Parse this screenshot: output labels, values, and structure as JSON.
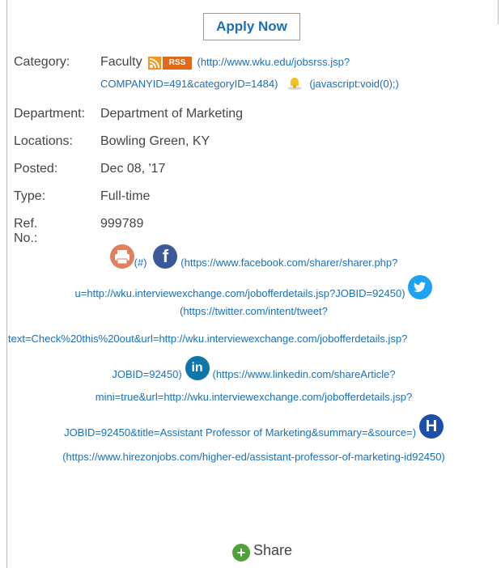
{
  "apply_label": "Apply Now",
  "fields": {
    "category_label": "Category:",
    "category_value": "Faculty",
    "rss_badge": "RSS",
    "rss_url_line1": "(http://www.wku.edu/jobsrss.jsp?",
    "rss_url_line2": "COMPANYID=491&categoryID=1484)",
    "alert_url": "(javascript:void(0);)",
    "department_label": "Department:",
    "department_value": "Department of Marketing",
    "locations_label": "Locations:",
    "locations_value": "Bowling Green, KY",
    "posted_label": "Posted:",
    "posted_value": "Dec 08, '17",
    "type_label": "Type:",
    "type_value": "Full-time",
    "ref_label": "Ref. No.:",
    "ref_value": "999789"
  },
  "share_links": {
    "print_href": "(#)",
    "facebook_line1": "(https://www.facebook.com/sharer/sharer.php?",
    "facebook_line2": "u=http://wku.interviewexchange.com/jobofferdetails.jsp?JOBID=92450)",
    "twitter_line1": "(https://twitter.com/intent/tweet?",
    "twitter_line2": "text=Check%20this%20out&url=http://wku.interviewexchange.com/jobofferdetails.jsp?",
    "twitter_line3": "JOBID=92450)",
    "linkedin_line1": "(https://www.linkedin.com/shareArticle?",
    "linkedin_line2": "mini=true&url=http://wku.interviewexchange.com/jobofferdetails.jsp?",
    "linkedin_line3": "JOBID=92450&title=Assistant Professor of Marketing&summary=&source=)",
    "hirezon_line": "(https://www.hirezonjobs.com/higher-ed/assistant-professor-of-marketing-id92450)",
    "share_label": "Share",
    "icon_print": "print-icon",
    "icon_facebook": "facebook-icon",
    "icon_twitter": "twitter-icon",
    "icon_linkedin": "linkedin-icon",
    "icon_hirezon": "hirezon-icon",
    "icon_share": "plus-icon"
  },
  "colors": {
    "link": "#1b6fb8",
    "print": "#e0805e",
    "facebook": "#3b5998",
    "twitter": "#1da1f2",
    "linkedin": "#0e76a8",
    "hirezon": "#1e4fa8",
    "share": "#4fa23a"
  }
}
